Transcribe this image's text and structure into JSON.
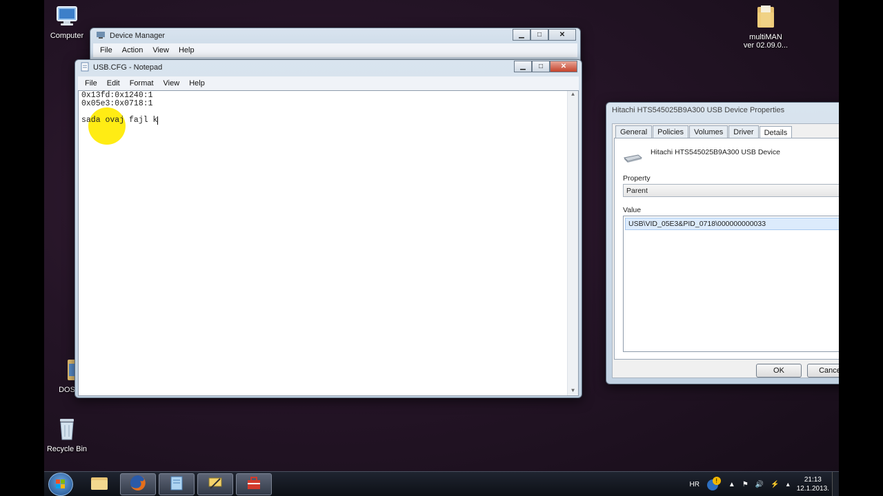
{
  "desktop": {
    "icons": {
      "computer": "Computer",
      "multiman_line1": "multiMAN",
      "multiman_line2": "ver 02.09.0...",
      "dos": "DOS",
      "recycle_bin": "Recycle Bin"
    }
  },
  "device_manager": {
    "title": "Device Manager",
    "menu": [
      "File",
      "Action",
      "View",
      "Help"
    ]
  },
  "notepad": {
    "title": "USB.CFG - Notepad",
    "menu": [
      "File",
      "Edit",
      "Format",
      "View",
      "Help"
    ],
    "lines": [
      "0x13fd:0x1240:1",
      "0x05e3:0x0718:1",
      "",
      "sada ovaj fajl k"
    ]
  },
  "properties": {
    "title": "Hitachi HTS545025B9A300 USB Device Properties",
    "tabs": [
      "General",
      "Policies",
      "Volumes",
      "Driver",
      "Details"
    ],
    "active_tab": "Details",
    "device_name": "Hitachi HTS545025B9A300 USB Device",
    "property_label": "Property",
    "property_value": "Parent",
    "value_label": "Value",
    "value_item": "USB\\VID_05E3&PID_0718\\000000000033",
    "ok_label": "OK",
    "cancel_label": "Cance"
  },
  "taskbar": {
    "language": "HR",
    "time": "21:13",
    "date": "12.1.2013."
  },
  "colors": {
    "highlight_marker": "#ffea00",
    "selection": "#dcebfc"
  }
}
